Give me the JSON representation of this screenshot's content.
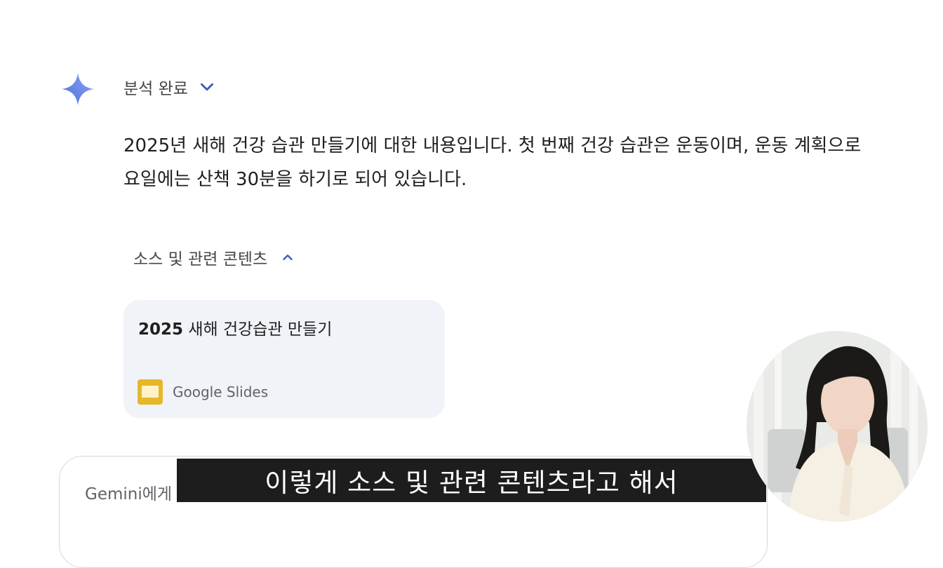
{
  "analysis": {
    "status_label": "분석 완료",
    "expand_icon": "chevron-down-icon"
  },
  "response": {
    "line1": "2025년 새해 건강 습관 만들기에 대한 내용입니다. 첫 번째 건강 습관은 운동이며, 운동 계획으로",
    "line2": "요일에는 산책 30분을 하기로 되어 있습니다."
  },
  "sources": {
    "toggle_label": "소스 및 관련 콘텐츠",
    "toggle_icon": "chevron-up-icon",
    "items": [
      {
        "title_num": "2025",
        "title_rest": " 새해 건강습관 만들기",
        "source_label": "Google Slides",
        "icon": "google-slides-icon",
        "icon_color": "#e7b72a"
      }
    ]
  },
  "prompt": {
    "placeholder": "Gemini에게"
  },
  "subtitle": {
    "text": "이렇게 소스 및 관련 콘텐츠라고 해서"
  },
  "colors": {
    "accent": "#3c5ab9",
    "card_bg": "#f0f4f9",
    "subtitle_bg": "#1d1d1d"
  }
}
